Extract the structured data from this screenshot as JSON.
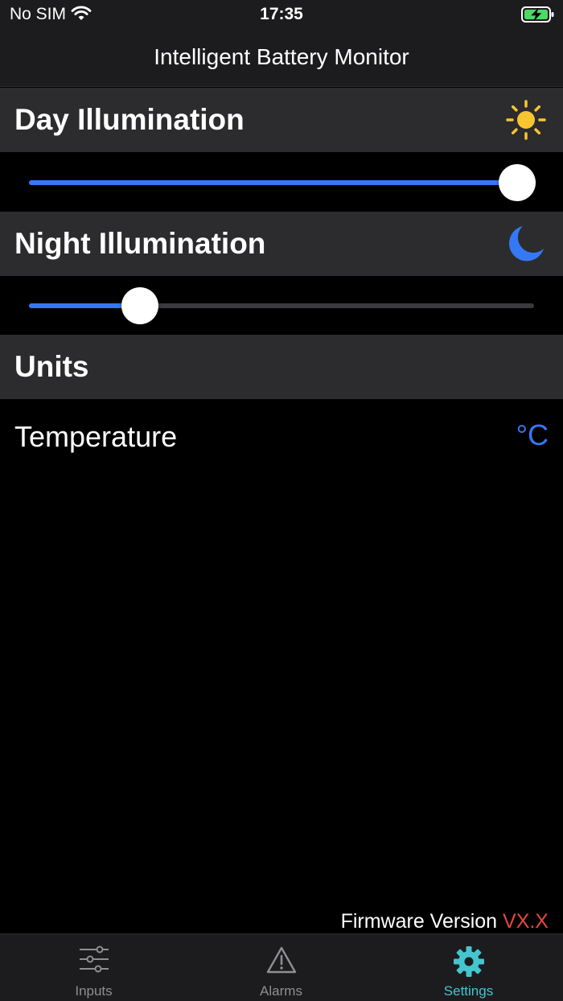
{
  "status_bar": {
    "carrier": "No SIM",
    "time": "17:35"
  },
  "nav": {
    "title": "Intelligent Battery Monitor"
  },
  "day": {
    "title": "Day Illumination",
    "icon": "sun-icon",
    "level": 1.0
  },
  "night": {
    "title": "Night Illumination",
    "icon": "moon-icon",
    "level": 0.22
  },
  "units": {
    "title": "Units",
    "temperature_label": "Temperature",
    "temperature_value": "°C"
  },
  "firmware": {
    "label": "Firmware Version ",
    "value": "VX.X"
  },
  "tabs": [
    {
      "label": "Inputs",
      "icon": "sliders-icon",
      "active": false
    },
    {
      "label": "Alarms",
      "icon": "warning-icon",
      "active": false
    },
    {
      "label": "Settings",
      "icon": "gear-icon",
      "active": true
    }
  ],
  "colors": {
    "accent_blue": "#3478f6",
    "sun_yellow": "#f7c531",
    "settings_teal": "#45c5cf",
    "firmware_red": "#e5473f"
  }
}
